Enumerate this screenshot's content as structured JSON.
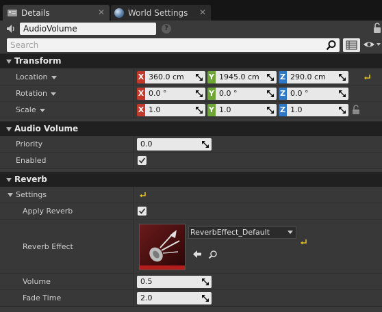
{
  "tabs": [
    {
      "label": "Details",
      "close": "✕"
    },
    {
      "label": "World Settings",
      "close": "✕"
    }
  ],
  "object": {
    "name": "AudioVolume",
    "help": "?"
  },
  "search": {
    "placeholder": "Search",
    "value": ""
  },
  "sections": {
    "transform": {
      "title": "Transform",
      "rows": {
        "location": {
          "label": "Location",
          "x": "360.0 cm",
          "y": "1945.0 cm",
          "z": "290.0 cm"
        },
        "rotation": {
          "label": "Rotation",
          "x": "0.0 °",
          "y": "0.0 °",
          "z": "0.0 °"
        },
        "scale": {
          "label": "Scale",
          "x": "1.0",
          "y": "1.0",
          "z": "1.0"
        }
      },
      "axes": {
        "x": "X",
        "y": "Y",
        "z": "Z"
      }
    },
    "audio_volume": {
      "title": "Audio Volume",
      "priority": {
        "label": "Priority",
        "value": "0.0"
      },
      "enabled": {
        "label": "Enabled",
        "checked": true
      }
    },
    "reverb": {
      "title": "Reverb",
      "settings": {
        "label": "Settings"
      },
      "apply_reverb": {
        "label": "Apply Reverb",
        "checked": true
      },
      "reverb_effect": {
        "label": "Reverb Effect",
        "value": "ReverbEffect_Default"
      },
      "volume": {
        "label": "Volume",
        "value": "0.5"
      },
      "fade_time": {
        "label": "Fade Time",
        "value": "2.0"
      }
    }
  },
  "colors": {
    "axis_x": "#c0392b",
    "axis_y": "#6fa63a",
    "axis_z": "#2f78c6",
    "reset_arrow": "#e6c21a"
  }
}
